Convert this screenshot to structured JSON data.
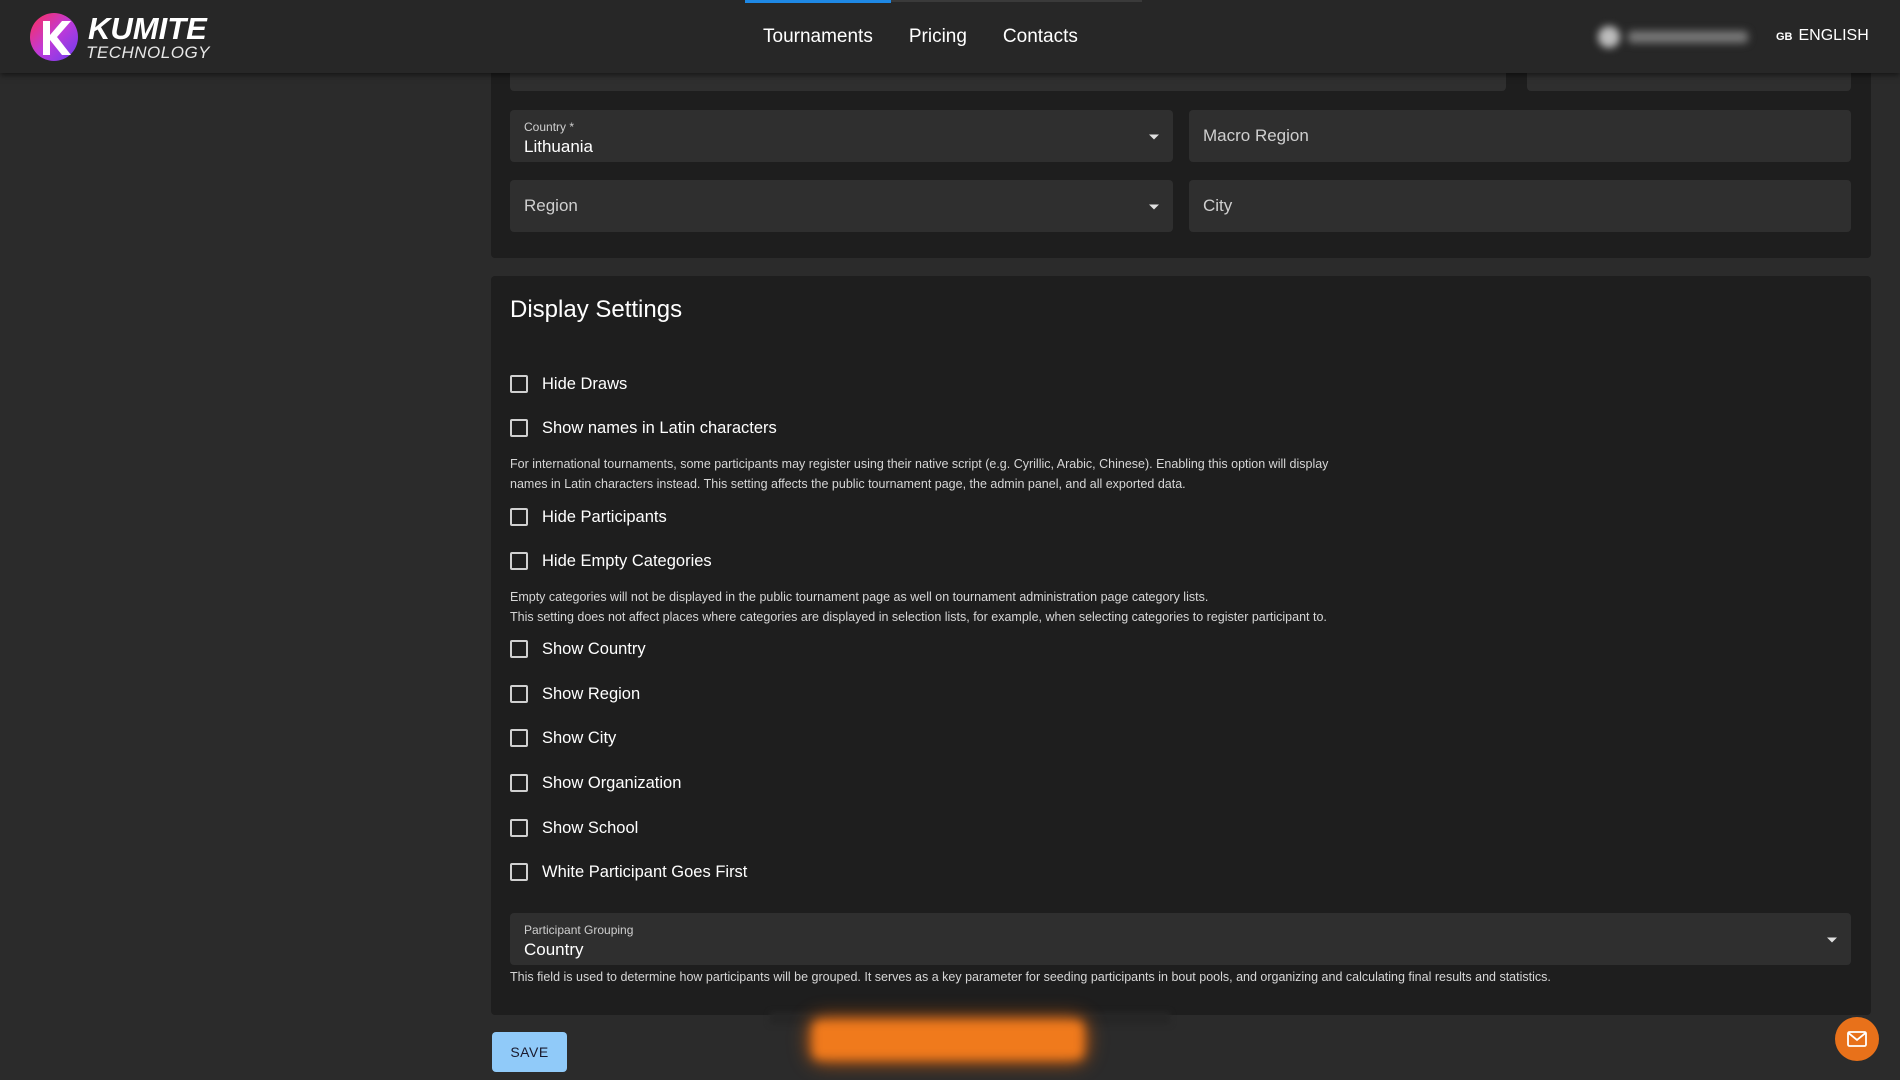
{
  "header": {
    "logo": {
      "title": "KUMITE",
      "subtitle": "TECHNOLOGY"
    },
    "nav": [
      {
        "label": "Tournaments"
      },
      {
        "label": "Pricing"
      },
      {
        "label": "Contacts"
      }
    ],
    "language": {
      "flag": "GB",
      "label": "ENGLISH"
    }
  },
  "location": {
    "country": {
      "label": "Country *",
      "value": "Lithuania"
    },
    "macro_region": {
      "placeholder": "Macro Region"
    },
    "region": {
      "placeholder": "Region"
    },
    "city": {
      "placeholder": "City"
    }
  },
  "display_settings": {
    "title": "Display Settings",
    "options": [
      {
        "label": "Hide Draws",
        "checked": false
      },
      {
        "label": "Show names in Latin characters",
        "checked": false
      },
      {
        "label": "Hide Participants",
        "checked": false
      },
      {
        "label": "Hide Empty Categories",
        "checked": false
      },
      {
        "label": "Show Country",
        "checked": false
      },
      {
        "label": "Show Region",
        "checked": false
      },
      {
        "label": "Show City",
        "checked": false
      },
      {
        "label": "Show Organization",
        "checked": false
      },
      {
        "label": "Show School",
        "checked": false
      },
      {
        "label": "White Participant Goes First",
        "checked": false
      }
    ],
    "latin_help_1": "For international tournaments, some participants may register using their native script (e.g. Cyrillic, Arabic, Chinese). Enabling this option will display",
    "latin_help_2": "names in Latin characters instead. This setting affects the public tournament page, the admin panel, and all exported data.",
    "empty_help_1": "Empty categories will not be displayed in the public tournament page as well on tournament administration page category lists.",
    "empty_help_2": "This setting does not affect places where categories are displayed in selection lists, for example, when selecting categories to register participant to.",
    "grouping": {
      "label": "Participant Grouping",
      "value": "Country",
      "help": "This field is used to determine how participants will be grouped. It serves as a key parameter for seeding participants in bout pools, and organizing and calculating final results and statistics."
    }
  },
  "actions": {
    "save_label": "SAVE"
  },
  "colors": {
    "accent": "#90caf9",
    "fab": "#e8711a",
    "card": "#1e1e1e",
    "field": "#2f2f2f"
  }
}
